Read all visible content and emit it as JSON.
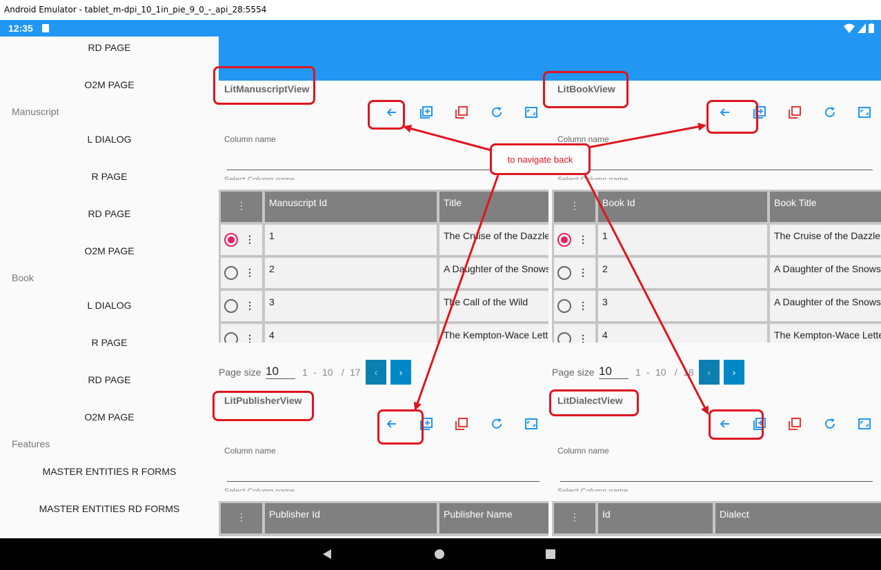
{
  "window": {
    "title": "Android Emulator - tablet_m-dpi_10_1in_pie_9_0_-_api_28:5554"
  },
  "status": {
    "time": "12:35"
  },
  "sidebar": {
    "items": [
      {
        "label": "RD PAGE",
        "type": "item"
      },
      {
        "label": "O2M PAGE",
        "type": "item"
      },
      {
        "label": "Manuscript",
        "type": "header"
      },
      {
        "label": "L DIALOG",
        "type": "item"
      },
      {
        "label": "R PAGE",
        "type": "item"
      },
      {
        "label": "RD PAGE",
        "type": "item"
      },
      {
        "label": "O2M PAGE",
        "type": "item"
      },
      {
        "label": "Book",
        "type": "header"
      },
      {
        "label": "L DIALOG",
        "type": "item"
      },
      {
        "label": "R PAGE",
        "type": "item"
      },
      {
        "label": "RD PAGE",
        "type": "item"
      },
      {
        "label": "O2M PAGE",
        "type": "item"
      },
      {
        "label": "Features",
        "type": "header"
      },
      {
        "label": "MASTER ENTITIES R FORMS",
        "type": "item"
      },
      {
        "label": "MASTER ENTITIES RD FORMS",
        "type": "item"
      }
    ]
  },
  "toolbar_icons": [
    "back-arrow-icon",
    "add-entry-icon",
    "copy-icon",
    "refresh-icon",
    "fullscreen-icon"
  ],
  "colors": {
    "accent": "#2196f3",
    "icon_blue": "#2196f3",
    "icon_red": "#e53935",
    "selected_radio": "#e91e63",
    "annotation": "#e0141e",
    "grid_header": "#808080"
  },
  "panels": {
    "manuscript": {
      "title": "LitManuscriptView",
      "column_field_label": "Column name",
      "column_field_hint": "Select Column name",
      "columns": [
        "⋮",
        "Manuscript Id",
        "Title"
      ],
      "rows": [
        {
          "selected": true,
          "id": "1",
          "name": "The Cruise of the Dazzler"
        },
        {
          "selected": false,
          "id": "2",
          "name": "A Daughter of the Snows"
        },
        {
          "selected": false,
          "id": "3",
          "name": "The Call of the Wild"
        },
        {
          "selected": false,
          "id": "4",
          "name": "The Kempton-Wace Letters"
        }
      ],
      "pager": {
        "label": "Page size",
        "size": "10",
        "from": "1",
        "sep": "-",
        "to": "10",
        "slash": "/",
        "total": "17"
      }
    },
    "book": {
      "title": "LitBookView",
      "column_field_label": "Column name",
      "column_field_hint": "Select Column name",
      "columns": [
        "⋮",
        "Book Id",
        "Book Title"
      ],
      "rows": [
        {
          "selected": true,
          "id": "1",
          "name": "The Cruise of the Dazzler"
        },
        {
          "selected": false,
          "id": "2",
          "name": "A Daughter of the Snows"
        },
        {
          "selected": false,
          "id": "3",
          "name": "A Daughter of the Snows"
        },
        {
          "selected": false,
          "id": "4",
          "name": "The Kempton-Wace Letters"
        }
      ],
      "pager": {
        "label": "Page size",
        "size": "10",
        "from": "1",
        "sep": "-",
        "to": "10",
        "slash": "/",
        "total": "18"
      }
    },
    "publisher": {
      "title": "LitPublisherView",
      "column_field_label": "Column name",
      "column_field_hint": "Select Column name",
      "columns": [
        "⋮",
        "Publisher Id",
        "Publisher Name"
      ]
    },
    "dialect": {
      "title": "LitDialectView",
      "column_field_label": "Column name",
      "column_field_hint": "Select Column name",
      "columns": [
        "⋮",
        "Id",
        "Dialect"
      ]
    }
  },
  "annotation": {
    "callout": "to navigate back"
  }
}
